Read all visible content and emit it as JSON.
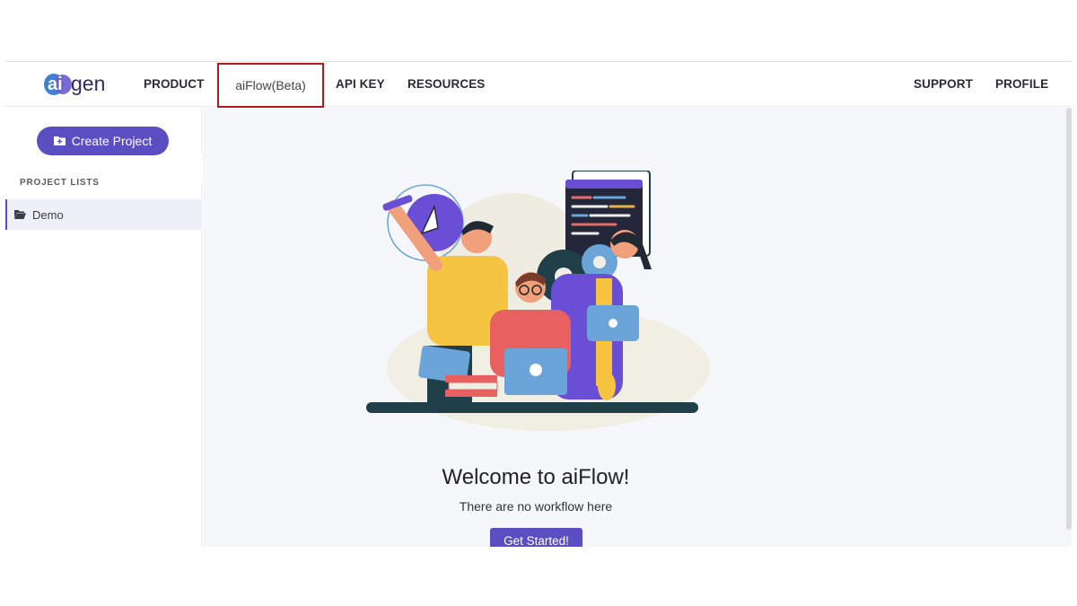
{
  "brand": {
    "logo_text": "aigen",
    "accent": "#5b4ec2"
  },
  "nav": {
    "product": "PRODUCT",
    "aiflow": "aiFlow(Beta)",
    "api_key": "API KEY",
    "resources": "RESOURCES",
    "support": "SUPPORT",
    "profile": "PROFILE"
  },
  "sidebar": {
    "create_label": "Create Project",
    "section_title": "PROJECT LISTS",
    "projects": [
      {
        "label": "Demo",
        "icon": "folder-open-icon"
      }
    ]
  },
  "main": {
    "welcome": "Welcome to aiFlow!",
    "subtitle": "There are no workflow here",
    "cta": "Get Started!"
  }
}
